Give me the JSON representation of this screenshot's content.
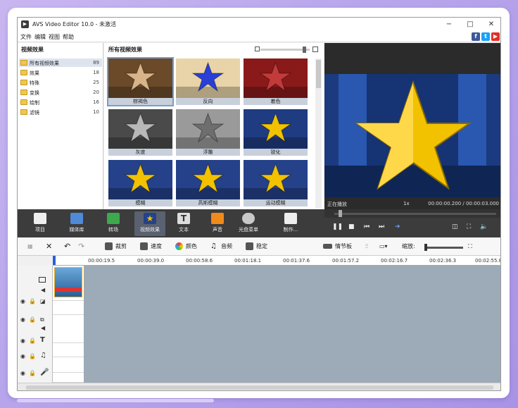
{
  "window": {
    "title": "AVS Video Editor 10.0 - 未激活",
    "controls": [
      "−",
      "□",
      "✕"
    ]
  },
  "menu": [
    "文件",
    "编辑",
    "视图",
    "帮助"
  ],
  "social": [
    {
      "icon": "facebook-icon",
      "glyph": "f",
      "color": "#3b5998"
    },
    {
      "icon": "twitter-icon",
      "glyph": "t",
      "color": "#1da1f2"
    },
    {
      "icon": "youtube-icon",
      "glyph": "▶",
      "color": "#e52d27"
    }
  ],
  "tree": {
    "title": "视频效果",
    "items": [
      {
        "label": "所有视频效果",
        "count": "89",
        "selected": true
      },
      {
        "label": "效果",
        "count": "18"
      },
      {
        "label": "特殊",
        "count": "25"
      },
      {
        "label": "变换",
        "count": "20"
      },
      {
        "label": "绘制",
        "count": "16"
      },
      {
        "label": "滤镜",
        "count": "10"
      }
    ]
  },
  "effects": {
    "title": "所有视频效果",
    "items": [
      {
        "label": "棕褐色",
        "bg": "#6b4a2a",
        "star": "#d9b48a",
        "selected": true
      },
      {
        "label": "反向",
        "bg": "#e8d4a8",
        "star": "#2a3fd6"
      },
      {
        "label": "着色",
        "bg": "#8a1a1a",
        "star": "#c23a3a"
      },
      {
        "label": "灰度",
        "bg": "#4a4a4a",
        "star": "#b8b8b8"
      },
      {
        "label": "浮雕",
        "bg": "#9a9a9a",
        "star": "#6e6e6e"
      },
      {
        "label": "锐化",
        "bg": "#1f3c82",
        "star": "#f2c200"
      },
      {
        "label": "模糊",
        "bg": "#24418a",
        "star": "#f2c200"
      },
      {
        "label": "高斯模糊",
        "bg": "#24418a",
        "star": "#f2c200"
      },
      {
        "label": "运动模糊",
        "bg": "#24418a",
        "star": "#f2c200"
      }
    ]
  },
  "preview": {
    "status": "正在播放",
    "speed": "1x",
    "time": "00:00:00.200 / 00:00:03.000"
  },
  "toolbar": [
    {
      "label": "项目",
      "icon": "clapper-icon"
    },
    {
      "label": "媒体库",
      "icon": "media-library-icon"
    },
    {
      "label": "转场",
      "icon": "transition-icon"
    },
    {
      "label": "视频效果",
      "icon": "video-effects-icon",
      "selected": true
    },
    {
      "label": "文本",
      "icon": "text-icon"
    },
    {
      "label": "声音",
      "icon": "microphone-icon"
    },
    {
      "label": "光盘菜单",
      "icon": "disc-menu-icon"
    },
    {
      "label": "制作...",
      "icon": "produce-icon"
    }
  ],
  "timeline_tools": {
    "cut": "裁剪",
    "speed": "速度",
    "color": "颜色",
    "audio": "音频",
    "stabilize": "稳定",
    "storyboard": "情节板",
    "zoom_label": "缩放:"
  },
  "ruler": [
    "00:00:19.5",
    "00:00:39.0",
    "00:00:58.6",
    "00:01:18.1",
    "00:01:37.6",
    "00:01:57.2",
    "00:02:16.7",
    "00:02:36.3",
    "00:02:55.8"
  ]
}
